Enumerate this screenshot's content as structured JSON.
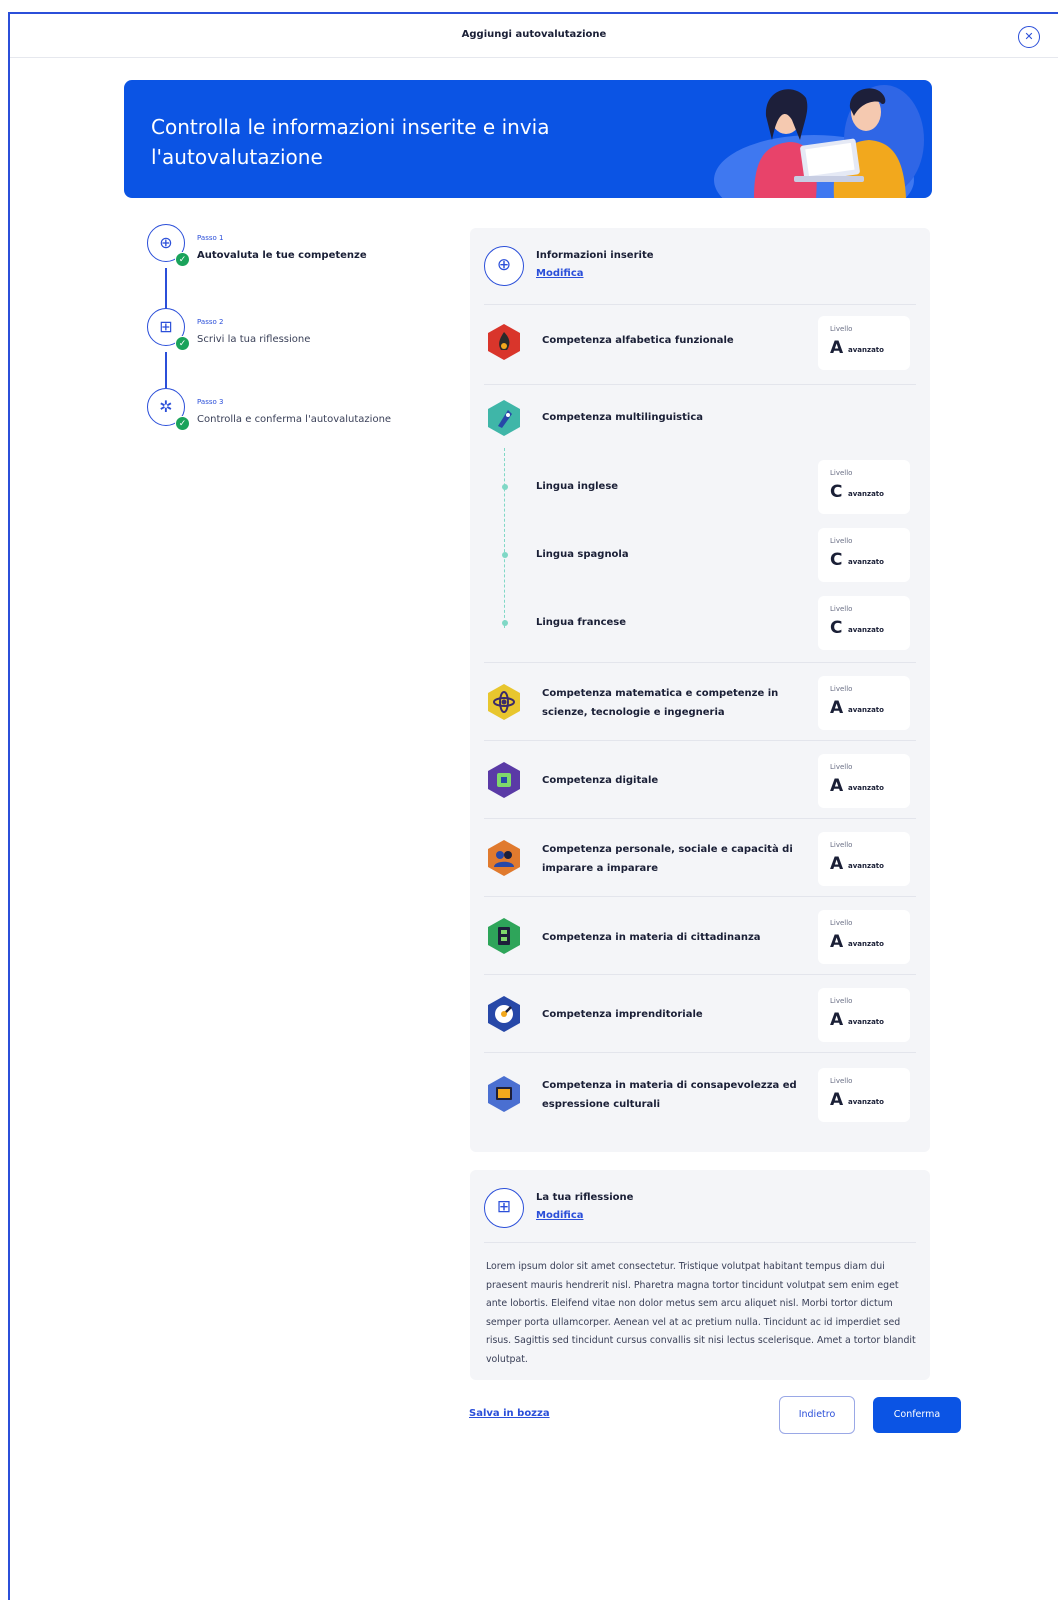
{
  "modal": {
    "title": "Aggiungi autovalutazione",
    "close_icon": "close-icon"
  },
  "hero": {
    "title": "Controlla le informazioni inserite e invia l'autovalutazione",
    "bg_color": "#0b54e4"
  },
  "steps": [
    {
      "label": "Passo 1",
      "text": "Autovaluta le tue competenze",
      "icon": "compass-icon",
      "done": true
    },
    {
      "label": "Passo 2",
      "text": "Scrivi la tua riflessione",
      "icon": "grid-icon",
      "done": true
    },
    {
      "label": "Passo 3",
      "text": "Controlla e conferma l'autovalutazione",
      "icon": "pinwheel-icon",
      "done": true
    }
  ],
  "info_panel": {
    "title": "Informazioni inserite",
    "edit_link": "Modifica",
    "level_label": "Livello",
    "competences": [
      {
        "name": "Competenza alfabetica funzionale",
        "level": "A",
        "level_desc": "avanzato",
        "color": "#d9352b",
        "icon": "flame-icon"
      },
      {
        "name": "Competenza multilinguistica",
        "level": "",
        "level_desc": "",
        "color": "#3fb6a8",
        "icon": "rocket-icon",
        "languages": [
          {
            "name": "Lingua inglese",
            "level": "C",
            "level_desc": "avanzato"
          },
          {
            "name": "Lingua spagnola",
            "level": "C",
            "level_desc": "avanzato"
          },
          {
            "name": "Lingua francese",
            "level": "C",
            "level_desc": "avanzato"
          }
        ]
      },
      {
        "name": "Competenza matematica e competenze in scienze, tecnologie e ingegneria",
        "level": "A",
        "level_desc": "avanzato",
        "color": "#e8c62e",
        "icon": "atom-icon"
      },
      {
        "name": "Competenza digitale",
        "level": "A",
        "level_desc": "avanzato",
        "color": "#5a3aa6",
        "icon": "chip-icon"
      },
      {
        "name": "Competenza personale, sociale e capacità di imparare a imparare",
        "level": "A",
        "level_desc": "avanzato",
        "color": "#e07a2e",
        "icon": "people-icon"
      },
      {
        "name": "Competenza in materia di cittadinanza",
        "level": "A",
        "level_desc": "avanzato",
        "color": "#2ea55a",
        "icon": "building-icon"
      },
      {
        "name": "Competenza imprenditoriale",
        "level": "A",
        "level_desc": "avanzato",
        "color": "#2748a8",
        "icon": "target-icon"
      },
      {
        "name": "Competenza in materia di consapevolezza ed espressione culturali",
        "level": "A",
        "level_desc": "avanzato",
        "color": "#4a6fd1",
        "icon": "frame-icon"
      }
    ]
  },
  "reflection_panel": {
    "title": "La tua riflessione",
    "edit_link": "Modifica",
    "text": "Lorem ipsum dolor sit amet consectetur. Tristique volutpat habitant tempus diam dui praesent mauris hendrerit nisl. Pharetra magna tortor tincidunt volutpat sem enim eget ante lobortis. Eleifend vitae non dolor metus sem arcu aliquet nisl. Morbi tortor dictum semper porta ullamcorper. Aenean vel at ac pretium nulla. Tincidunt ac id imperdiet sed risus. Sagittis sed tincidunt cursus convallis sit nisi lectus scelerisque. Amet a tortor blandit volutpat."
  },
  "footer": {
    "save_link": "Salva in bozza",
    "back_button": "Indietro",
    "confirm_button": "Conferma"
  }
}
